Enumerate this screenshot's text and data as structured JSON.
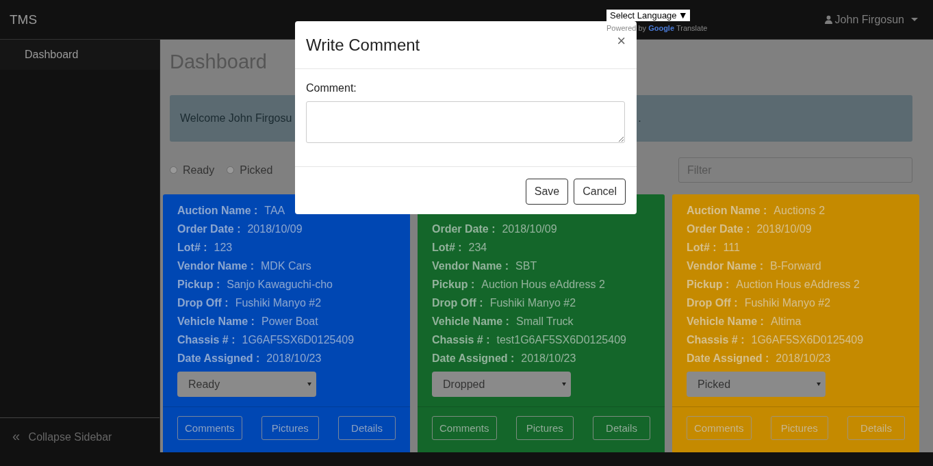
{
  "brand": "TMS",
  "language": {
    "label": "Select Language",
    "caret": "▼",
    "powered": "Powered",
    "by": "by",
    "google": "Google",
    "translate": "Translate"
  },
  "user": {
    "name": "John Firgosun"
  },
  "sidebar": {
    "items": [
      {
        "label": "Dashboard",
        "selected": true
      }
    ],
    "collapse": {
      "icon": "«",
      "label": "Collapse Sidebar"
    }
  },
  "page": {
    "title": "Dashboard",
    "welcome": "Welcome John Firgosu",
    "welcome_tail": ".",
    "filters": [
      {
        "label": "Ready",
        "selected": false
      },
      {
        "label": "Picked",
        "selected": false
      }
    ],
    "filter_placeholder": "Filter"
  },
  "cards": [
    {
      "color": "#0047b3",
      "fields": [
        {
          "label": "Auction Name :",
          "value": "TAA"
        },
        {
          "label": "Order Date :",
          "value": "2018/10/09"
        },
        {
          "label": "Lot# :",
          "value": "123"
        },
        {
          "label": "Vendor Name :",
          "value": "MDK Cars"
        },
        {
          "label": "Pickup :",
          "value": "Sanjo Kawaguchi-cho"
        },
        {
          "label": "Drop Off :",
          "value": "Fushiki Manyo #2"
        },
        {
          "label": "Vehicle Name :",
          "value": "Power Boat"
        },
        {
          "label": "Chassis # :",
          "value": "1G6AF5SX6D0125409"
        },
        {
          "label": "Date Assigned :",
          "value": "2018/10/23"
        }
      ],
      "status": "Ready",
      "buttons": [
        "Comments",
        "Pictures",
        "Details"
      ]
    },
    {
      "color": "#14662a",
      "fields": [
        {
          "label": "Order Date :",
          "value": "2018/10/09"
        },
        {
          "label": "Lot# :",
          "value": "234"
        },
        {
          "label": "Vendor Name :",
          "value": "SBT"
        },
        {
          "label": "Pickup :",
          "value": "Auction Hous eAddress 2"
        },
        {
          "label": "Drop Off :",
          "value": "Fushiki Manyo #2"
        },
        {
          "label": "Vehicle Name :",
          "value": "Small Truck"
        },
        {
          "label": "Chassis # :",
          "value": "test1G6AF5SX6D0125409"
        },
        {
          "label": "Date Assigned :",
          "value": "2018/10/23"
        }
      ],
      "status": "Dropped",
      "buttons": [
        "Comments",
        "Pictures",
        "Details"
      ]
    },
    {
      "color": "#c58a00",
      "fields": [
        {
          "label": "Auction Name :",
          "value": "Auctions 2"
        },
        {
          "label": "Order Date :",
          "value": "2018/10/09"
        },
        {
          "label": "Lot# :",
          "value": "111"
        },
        {
          "label": "Vendor Name :",
          "value": "B-Forward"
        },
        {
          "label": "Pickup :",
          "value": "Auction Hous eAddress 2"
        },
        {
          "label": "Drop Off :",
          "value": "Fushiki Manyo #2"
        },
        {
          "label": "Vehicle Name :",
          "value": "Altima"
        },
        {
          "label": "Chassis # :",
          "value": "1G6AF5SX6D0125409"
        },
        {
          "label": "Date Assigned :",
          "value": "2018/10/23"
        }
      ],
      "status": "Picked",
      "buttons": [
        "Comments",
        "Pictures",
        "Details"
      ]
    }
  ],
  "modal": {
    "title": "Write Comment",
    "close": "×",
    "field_label": "Comment:",
    "buttons": [
      "Save",
      "Cancel"
    ]
  }
}
